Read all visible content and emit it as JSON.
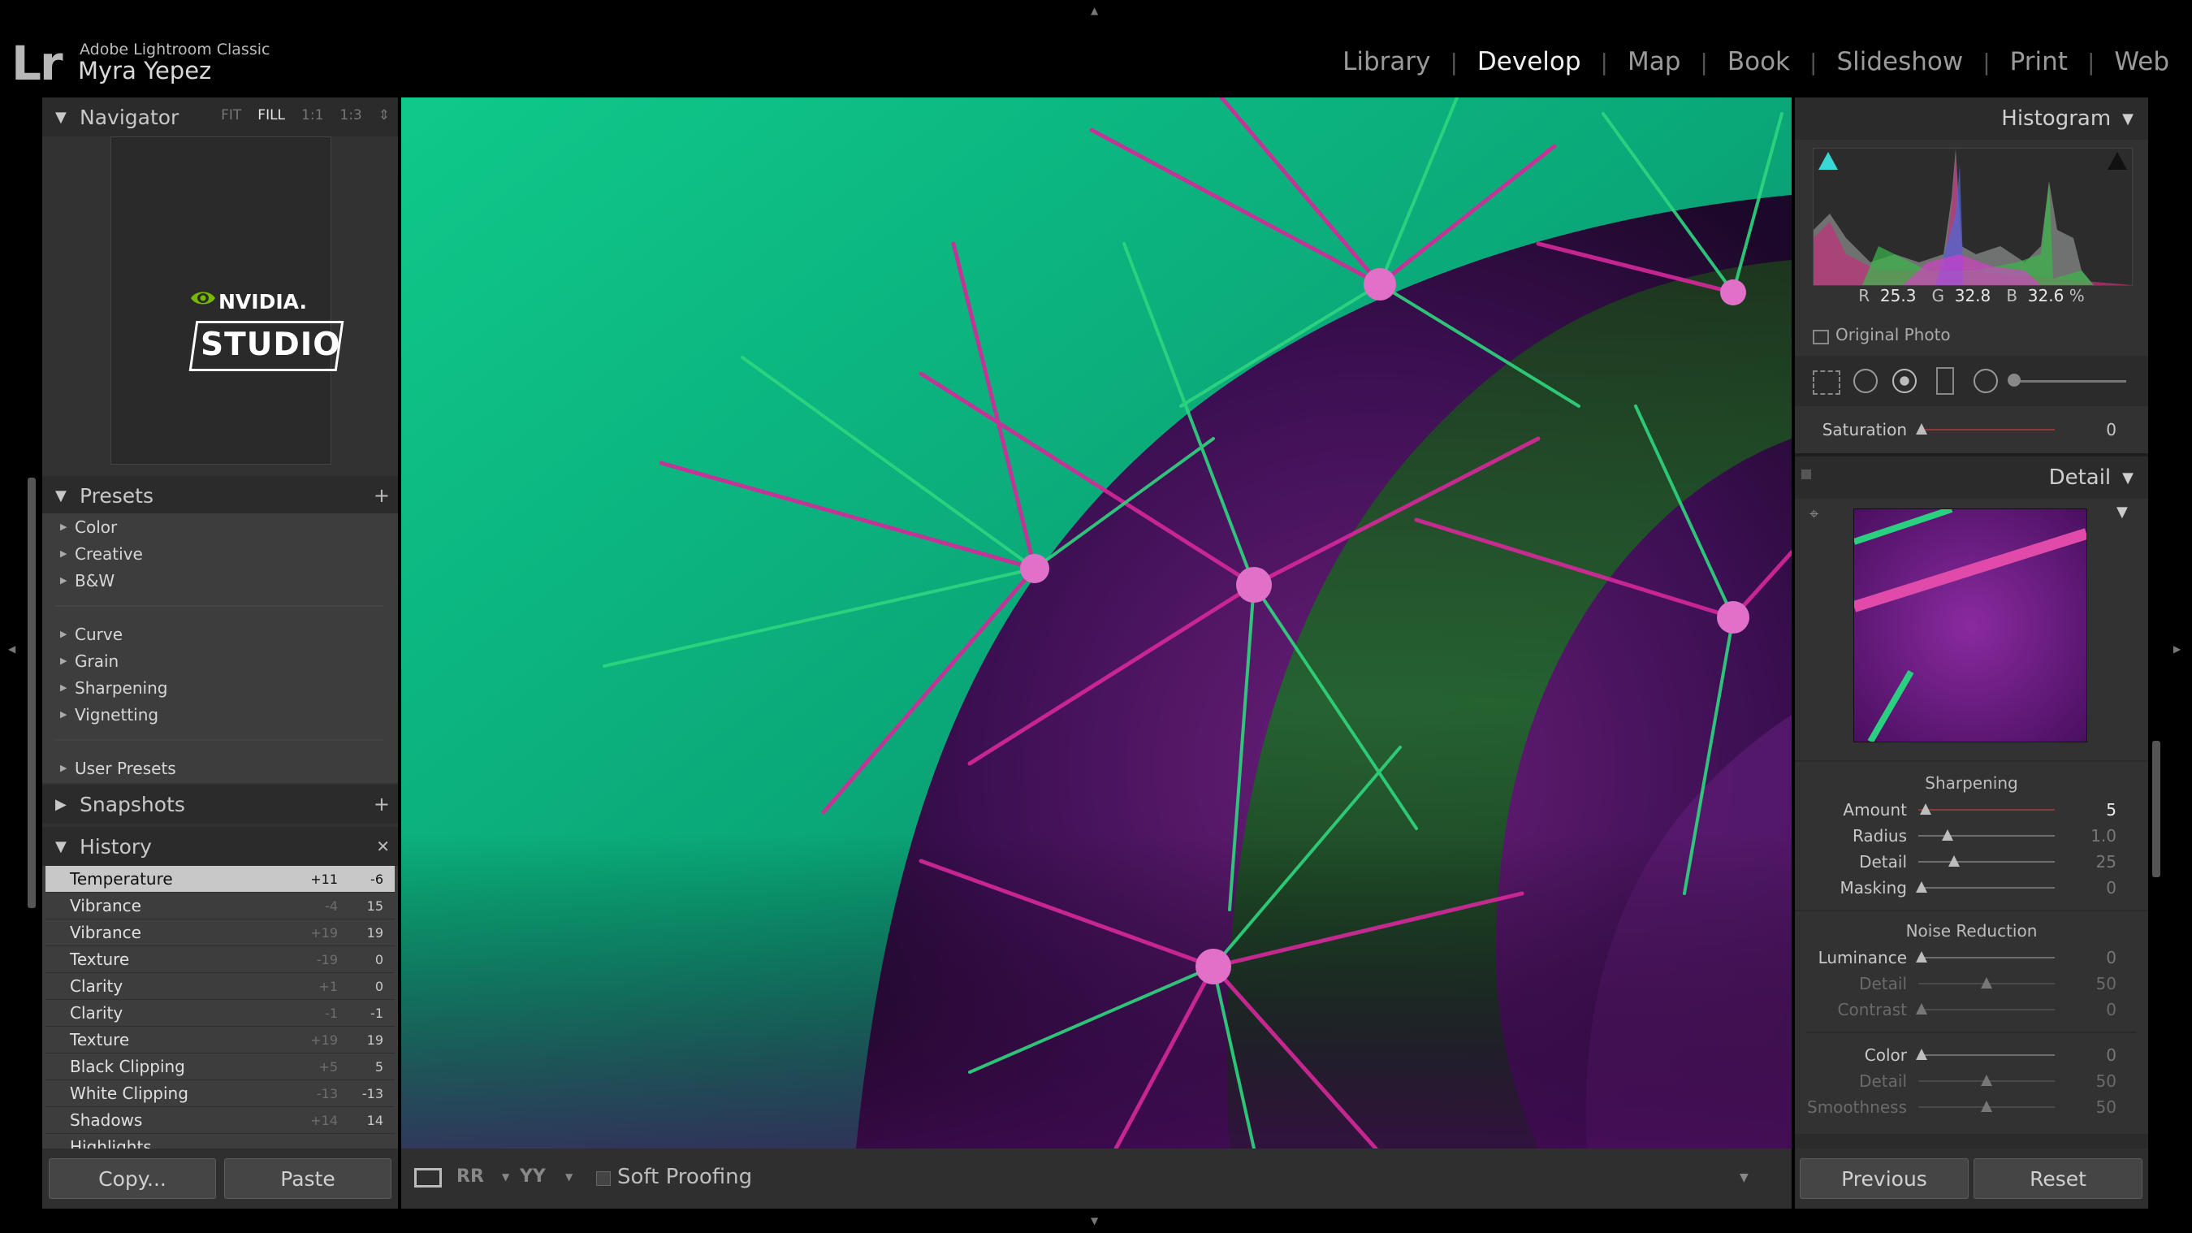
{
  "app": {
    "logo": "Lr",
    "name": "Adobe Lightroom Classic",
    "user": "Myra Yepez"
  },
  "modules": [
    {
      "label": "Library",
      "active": false
    },
    {
      "label": "Develop",
      "active": true
    },
    {
      "label": "Map",
      "active": false
    },
    {
      "label": "Book",
      "active": false
    },
    {
      "label": "Slideshow",
      "active": false
    },
    {
      "label": "Print",
      "active": false
    },
    {
      "label": "Web",
      "active": false
    }
  ],
  "navigator": {
    "title": "Navigator",
    "options": [
      "FIT",
      "FILL",
      "1:1",
      "1:3"
    ],
    "active_option": "FILL",
    "preview": {
      "brand": "NVIDIA.",
      "product": "STUDIO"
    }
  },
  "presets": {
    "title": "Presets",
    "group1": [
      "Color",
      "Creative",
      "B&W"
    ],
    "group2": [
      "Curve",
      "Grain",
      "Sharpening",
      "Vignetting"
    ],
    "group3": [
      "User Presets"
    ]
  },
  "snapshots": {
    "title": "Snapshots"
  },
  "history": {
    "title": "History",
    "items": [
      {
        "name": "Temperature",
        "before": "+11",
        "after": "-6",
        "selected": true
      },
      {
        "name": "Vibrance",
        "before": "-4",
        "after": "15"
      },
      {
        "name": "Vibrance",
        "before": "+19",
        "after": "19"
      },
      {
        "name": "Texture",
        "before": "-19",
        "after": "0"
      },
      {
        "name": "Clarity",
        "before": "+1",
        "after": "0"
      },
      {
        "name": "Clarity",
        "before": "-1",
        "after": "-1"
      },
      {
        "name": "Texture",
        "before": "+19",
        "after": "19"
      },
      {
        "name": "Black Clipping",
        "before": "+5",
        "after": "5"
      },
      {
        "name": "White Clipping",
        "before": "-13",
        "after": "-13"
      },
      {
        "name": "Shadows",
        "before": "+14",
        "after": "14"
      },
      {
        "name": "Highlights",
        "before": "",
        "after": ""
      }
    ]
  },
  "left_buttons": {
    "copy": "Copy...",
    "paste": "Paste"
  },
  "toolbar": {
    "soft_proofing": "Soft Proofing"
  },
  "histogram": {
    "title": "Histogram",
    "r_label": "R",
    "r": "25.3",
    "g_label": "G",
    "g": "32.8",
    "b_label": "B",
    "b": "32.6",
    "unit": "%",
    "original_photo": "Original Photo"
  },
  "saturation": {
    "label": "Saturation",
    "value": "0",
    "level": 0.0
  },
  "detail": {
    "title": "Detail",
    "sharpening_title": "Sharpening",
    "sharpening": [
      {
        "label": "Amount",
        "value": "5",
        "level": 0.03,
        "dim": false
      },
      {
        "label": "Radius",
        "value": "1.0",
        "level": 0.2,
        "dim": false
      },
      {
        "label": "Detail",
        "value": "25",
        "level": 0.25,
        "dim": false
      },
      {
        "label": "Masking",
        "value": "0",
        "level": 0.0,
        "dim": false
      }
    ],
    "noise_title": "Noise Reduction",
    "noise": [
      {
        "label": "Luminance",
        "value": "0",
        "level": 0.0,
        "dim": false
      },
      {
        "label": "Detail",
        "value": "50",
        "level": 0.5,
        "dim": true
      },
      {
        "label": "Contrast",
        "value": "0",
        "level": 0.0,
        "dim": true
      }
    ],
    "color": [
      {
        "label": "Color",
        "value": "0",
        "level": 0.0,
        "dim": false
      },
      {
        "label": "Detail",
        "value": "50",
        "level": 0.5,
        "dim": true
      },
      {
        "label": "Smoothness",
        "value": "50",
        "level": 0.5,
        "dim": true
      }
    ]
  },
  "right_buttons": {
    "previous": "Previous",
    "reset": "Reset"
  }
}
